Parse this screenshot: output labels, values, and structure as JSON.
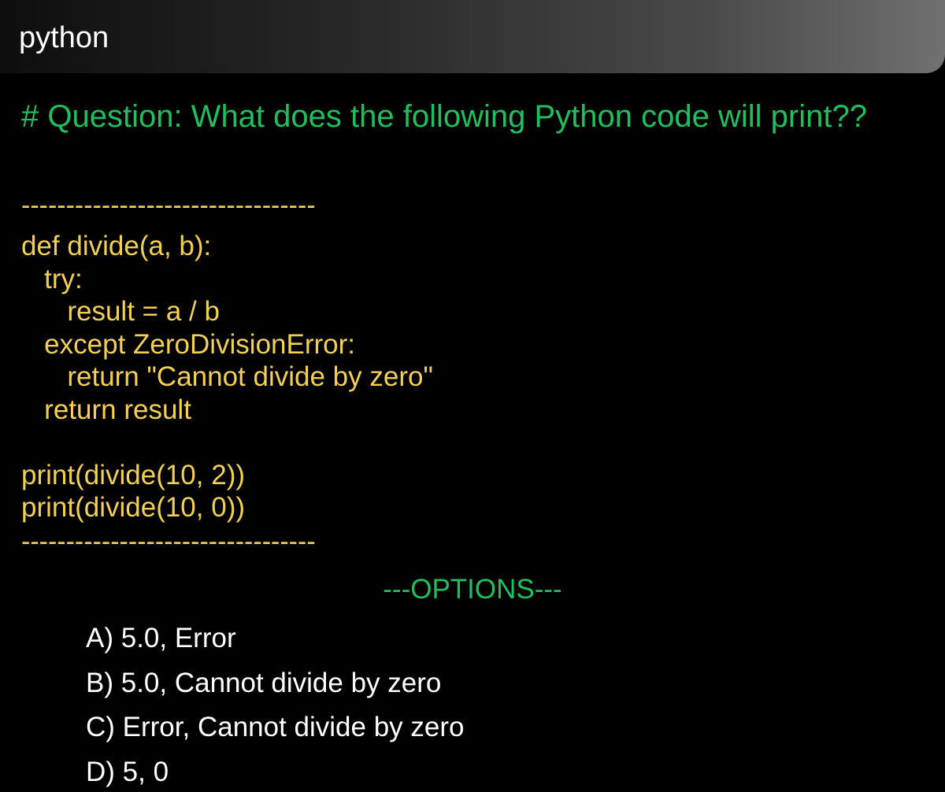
{
  "header": {
    "title": "python"
  },
  "question": {
    "text": "# Question: What does the following Python code will print??"
  },
  "divider": "---------------------------------",
  "code": {
    "lines": [
      "def divide(a, b):",
      "   try:",
      "      result = a / b",
      "   except ZeroDivisionError:",
      "      return \"Cannot divide by zero\"",
      "   return result",
      "",
      "print(divide(10, 2))",
      "print(divide(10, 0))"
    ]
  },
  "options": {
    "heading": "---OPTIONS---",
    "items": [
      "A) 5.0, Error",
      "B) 5.0, Cannot divide by zero",
      "C) Error, Cannot divide by zero",
      "D) 5, 0"
    ]
  },
  "colors": {
    "background": "#000000",
    "question_green": "#1fbf5f",
    "code_yellow": "#f2cf55",
    "option_white": "#ffffff"
  }
}
